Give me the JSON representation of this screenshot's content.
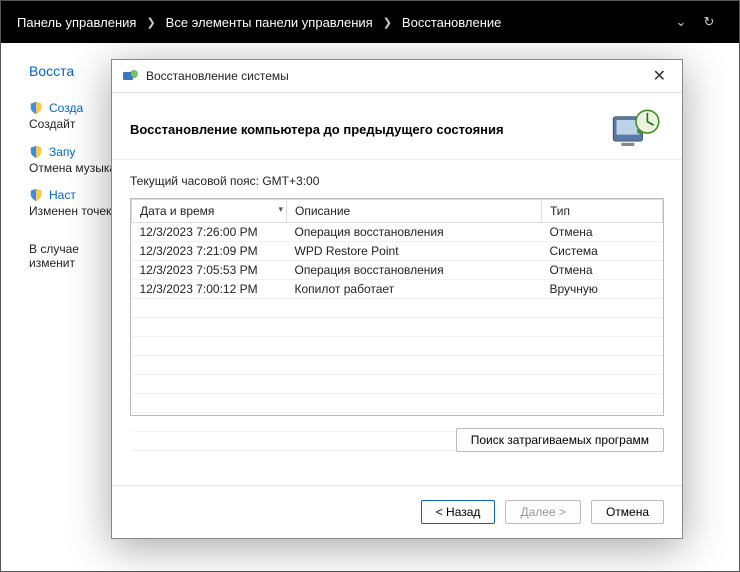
{
  "breadcrumb": {
    "items": [
      "Панель управления",
      "Все элементы панели управления",
      "Восстановление"
    ]
  },
  "background": {
    "title_truncated": "Восста",
    "links": {
      "create": "Созда",
      "create_sub": "Создайт",
      "run": "Запу",
      "run_sub": "Отмена музыка,",
      "config": "Наст",
      "config_sub": "Изменен точек во"
    },
    "open_text": "В случае",
    "open_text2": "изменит"
  },
  "dialog": {
    "title": "Восстановление системы",
    "headline": "Восстановление компьютера до предыдущего состояния",
    "timezone": "Текущий часовой пояс: GMT+3:00",
    "columns": {
      "datetime": "Дата и время",
      "description": "Описание",
      "type": "Тип"
    },
    "rows": [
      {
        "dt": "12/3/2023 7:26:00 PM",
        "desc": "Операция восстановления",
        "type": "Отмена"
      },
      {
        "dt": "12/3/2023 7:21:09 PM",
        "desc": "WPD Restore Point",
        "type": "Система"
      },
      {
        "dt": "12/3/2023 7:05:53 PM",
        "desc": "Операция восстановления",
        "type": "Отмена"
      },
      {
        "dt": "12/3/2023 7:00:12 PM",
        "desc": "Копилот работает",
        "type": "Вручную"
      }
    ],
    "scan_button": "Поиск затрагиваемых программ",
    "back": "< Назад",
    "next": "Далее >",
    "cancel": "Отмена"
  }
}
